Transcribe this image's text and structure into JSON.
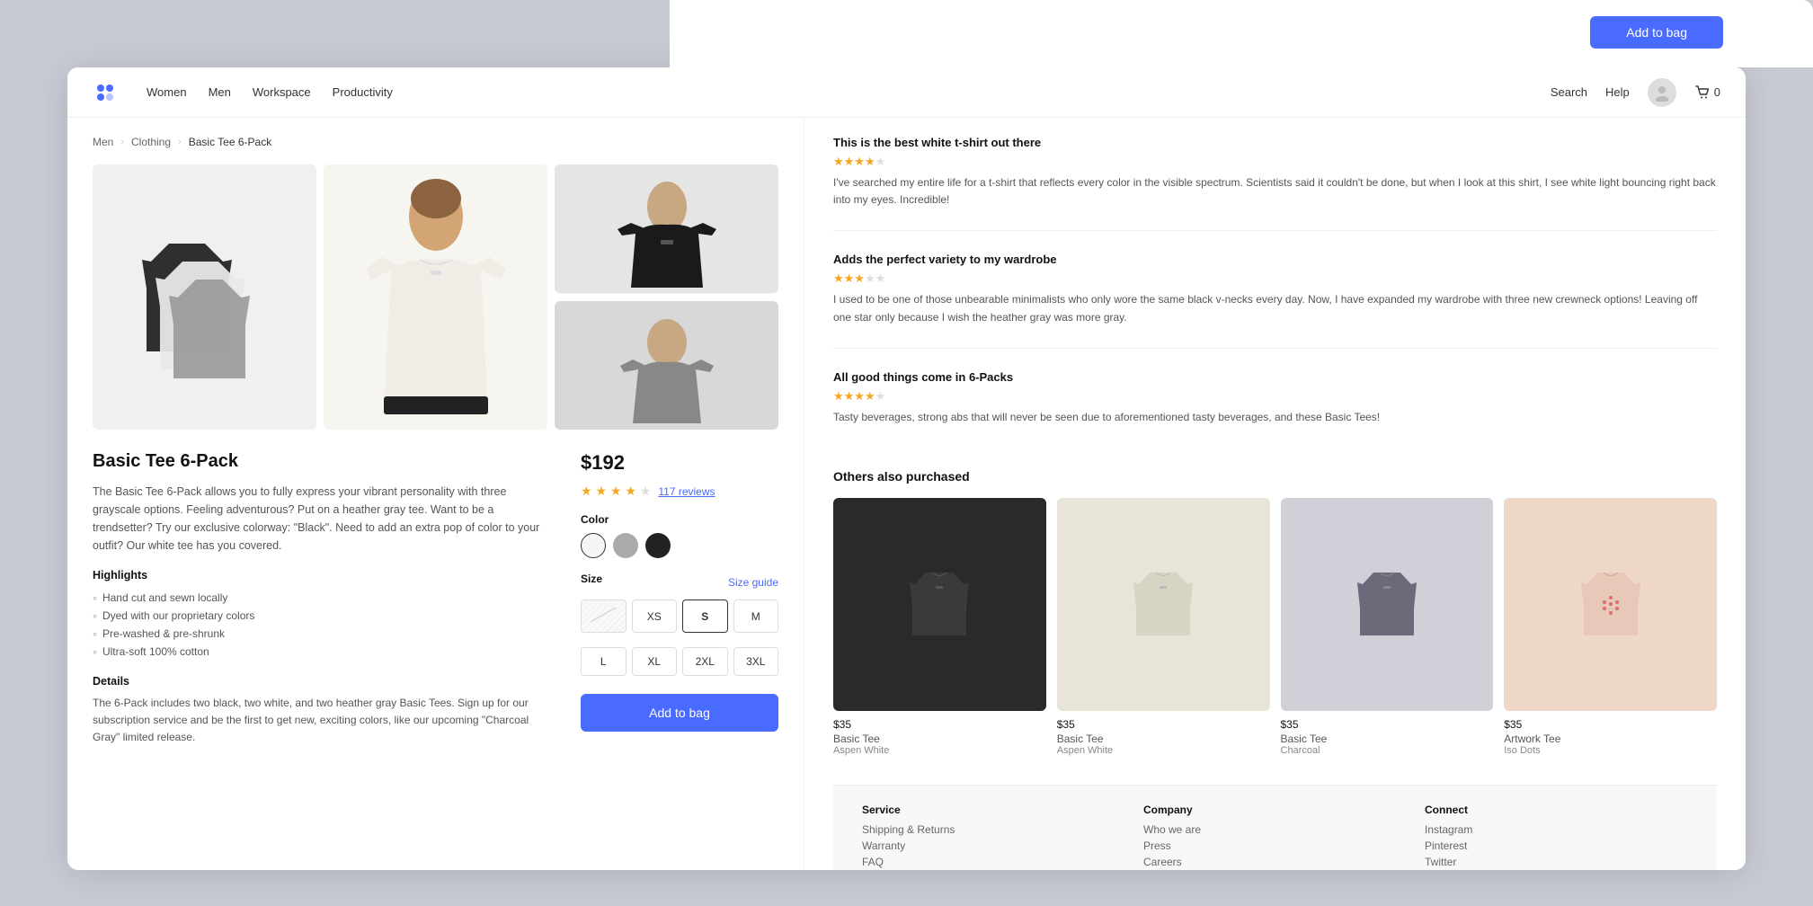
{
  "header": {
    "nav": [
      "Women",
      "Men",
      "Workspace",
      "Productivity"
    ],
    "search_label": "Search",
    "help_label": "Help",
    "cart_count": "0"
  },
  "breadcrumb": [
    "Men",
    "Clothing",
    "Basic Tee 6-Pack"
  ],
  "product": {
    "title": "Basic Tee 6-Pack",
    "description": "The Basic Tee 6-Pack allows you to fully express your vibrant personality with three grayscale options. Feeling adventurous? Put on a heather gray tee. Want to be a trendsetter? Try our exclusive colorway: \"Black\". Need to add an extra pop of color to your outfit? Our white tee has you covered.",
    "highlights_title": "Highlights",
    "highlights": [
      "Hand cut and sewn locally",
      "Dyed with our proprietary colors",
      "Pre-washed & pre-shrunk",
      "Ultra-soft 100% cotton"
    ],
    "details_title": "Details",
    "details_text": "The 6-Pack includes two black, two white, and two heather gray Basic Tees. Sign up for our subscription service and be the first to get new, exciting colors, like our upcoming \"Charcoal Gray\" limited release.",
    "price": "$192",
    "rating_stars": 4,
    "rating_max": 5,
    "review_count": "117 reviews",
    "color_label": "Color",
    "colors": [
      "white",
      "gray",
      "black"
    ],
    "size_label": "Size",
    "size_guide": "Size guide",
    "sizes_row1": [
      "XS out of stock",
      "XS",
      "S",
      "M"
    ],
    "sizes_row2": [
      "L",
      "XL",
      "2XL",
      "3XL"
    ],
    "selected_size": "S",
    "add_to_bag": "Add to bag"
  },
  "reviews": [
    {
      "title": "This is the best white t-shirt out there",
      "stars": 4,
      "text": "I've searched my entire life for a t-shirt that reflects every color in the visible spectrum. Scientists said it couldn't be done, but when I look at this shirt, I see white light bouncing right back into my eyes. Incredible!"
    },
    {
      "title": "Adds the perfect variety to my wardrobe",
      "stars": 3,
      "text": "I used to be one of those unbearable minimalists who only wore the same black v-necks every day. Now, I have expanded my wardrobe with three new crewneck options! Leaving off one star only because I wish the heather gray was more gray."
    },
    {
      "title": "All good things come in 6-Packs",
      "stars": 4,
      "text": "Tasty beverages, strong abs that will never be seen due to aforementioned tasty beverages, and these Basic Tees!"
    }
  ],
  "also_purchased": {
    "title": "Others also purchased",
    "items": [
      {
        "price": "$35",
        "name": "Basic Tee",
        "sub": "Aspen White",
        "bg": "#2a2a2a"
      },
      {
        "price": "$35",
        "name": "Basic Tee",
        "sub": "Aspen White",
        "bg": "#e8e4d8"
      },
      {
        "price": "$35",
        "name": "Basic Tee",
        "sub": "Charcoal",
        "bg": "#5a5a6a"
      },
      {
        "price": "$35",
        "name": "Artwork Tee",
        "sub": "Iso Dots",
        "bg": "#f0d8c8"
      }
    ]
  },
  "footer": {
    "service_title": "Service",
    "service_links": [
      "Shipping & Returns",
      "Warranty",
      "FAQ"
    ],
    "company_title": "Company",
    "company_links": [
      "Who we are",
      "Press",
      "Careers"
    ],
    "connect_title": "Connect",
    "connect_links": [
      "Instagram",
      "Pinterest",
      "Twitter"
    ]
  },
  "top_add_btn": "Add to bag"
}
